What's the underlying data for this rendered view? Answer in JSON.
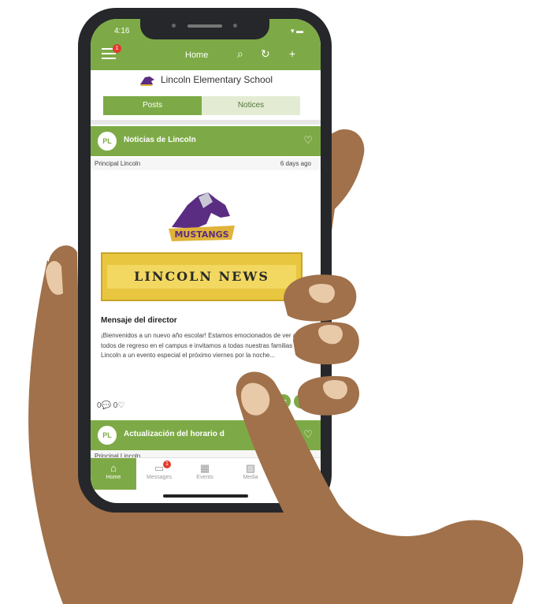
{
  "status": {
    "time": "4:16"
  },
  "header": {
    "title": "Home",
    "menu_badge": "1"
  },
  "school": {
    "name": "Lincoln Elementary School"
  },
  "tabs": [
    {
      "label": "Posts"
    },
    {
      "label": "Notices"
    }
  ],
  "posts": [
    {
      "avatar": "PL",
      "title": "Noticias de Lincoln",
      "author": "Principal Lincoln",
      "age": "6 days ago",
      "image_logo_text": "MUSTANGS",
      "banner_text": "LINCOLN NEWS",
      "article_title": "Mensaje del director",
      "article_body": "¡Bienvenidos a un nuevo año escolar! Estamos emocionados de ver a todos de regreso en el campus e invitamos a todas nuestras familias de Lincoln a un evento especial el próximo viernes por la noche...",
      "comments": "0",
      "likes": "0"
    },
    {
      "avatar": "PL",
      "title": "Actualización del horario d",
      "author": "Principal Lincoln"
    }
  ],
  "bottom_nav": [
    {
      "label": "Home",
      "icon": "house-icon"
    },
    {
      "label": "Messages",
      "icon": "chat-icon",
      "badge": "1"
    },
    {
      "label": "Events",
      "icon": "calendar-icon"
    },
    {
      "label": "Media",
      "icon": "image-icon"
    }
  ],
  "colors": {
    "accent": "#7daa46",
    "badge": "#e23b2e",
    "skin": "#a0714a"
  }
}
